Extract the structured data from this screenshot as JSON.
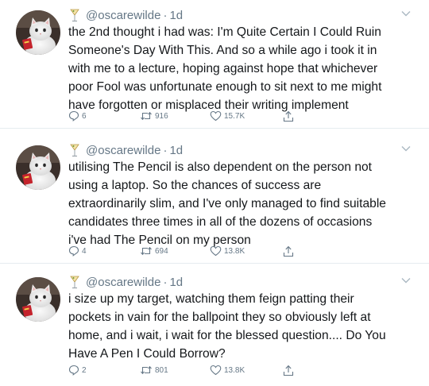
{
  "tweets": [
    {
      "handle": "@oscarewilde",
      "separator": "·",
      "time": "1d",
      "text": "the 2nd thought i had was: I'm Quite Certain I Could Ruin\nSomeone's Day With This. And so a while ago i took it in\nwith me to a lecture, hoping against hope that whichever\npoor Fool was unfortunate enough to sit next to me might\nhave forgotten or misplaced their writing implement",
      "replies": "6",
      "retweets": "916",
      "likes": "15.7K"
    },
    {
      "handle": "@oscarewilde",
      "separator": "·",
      "time": "1d",
      "text": "utilising The Pencil is also dependent on the person not\nusing a laptop. So the chances of success are\nextraordinarily slim, and I've only managed to find suitable\ncandidates three times in all of the dozens of occasions\ni've had The Pencil on my person",
      "replies": "4",
      "retweets": "694",
      "likes": "13.8K"
    },
    {
      "handle": "@oscarewilde",
      "separator": "·",
      "time": "1d",
      "text": "i size up my target, watching them feign patting their\npockets in vain for the ballpoint they so obviously left at\nhome, and i wait, i wait for the blessed question.... Do You\nHave A Pen I Could Borrow?",
      "replies": "2",
      "retweets": "801",
      "likes": "13.8K"
    }
  ],
  "icons": {
    "avatar": "white-cat-with-red-object",
    "name_emoji": "cocktail-glass-icon",
    "caret": "chevron-down-icon",
    "reply": "reply-icon",
    "retweet": "retweet-icon",
    "like": "heart-icon",
    "share": "share-icon"
  },
  "colors": {
    "text": "#14171a",
    "muted": "#657786",
    "divider": "#e6ecf0"
  }
}
